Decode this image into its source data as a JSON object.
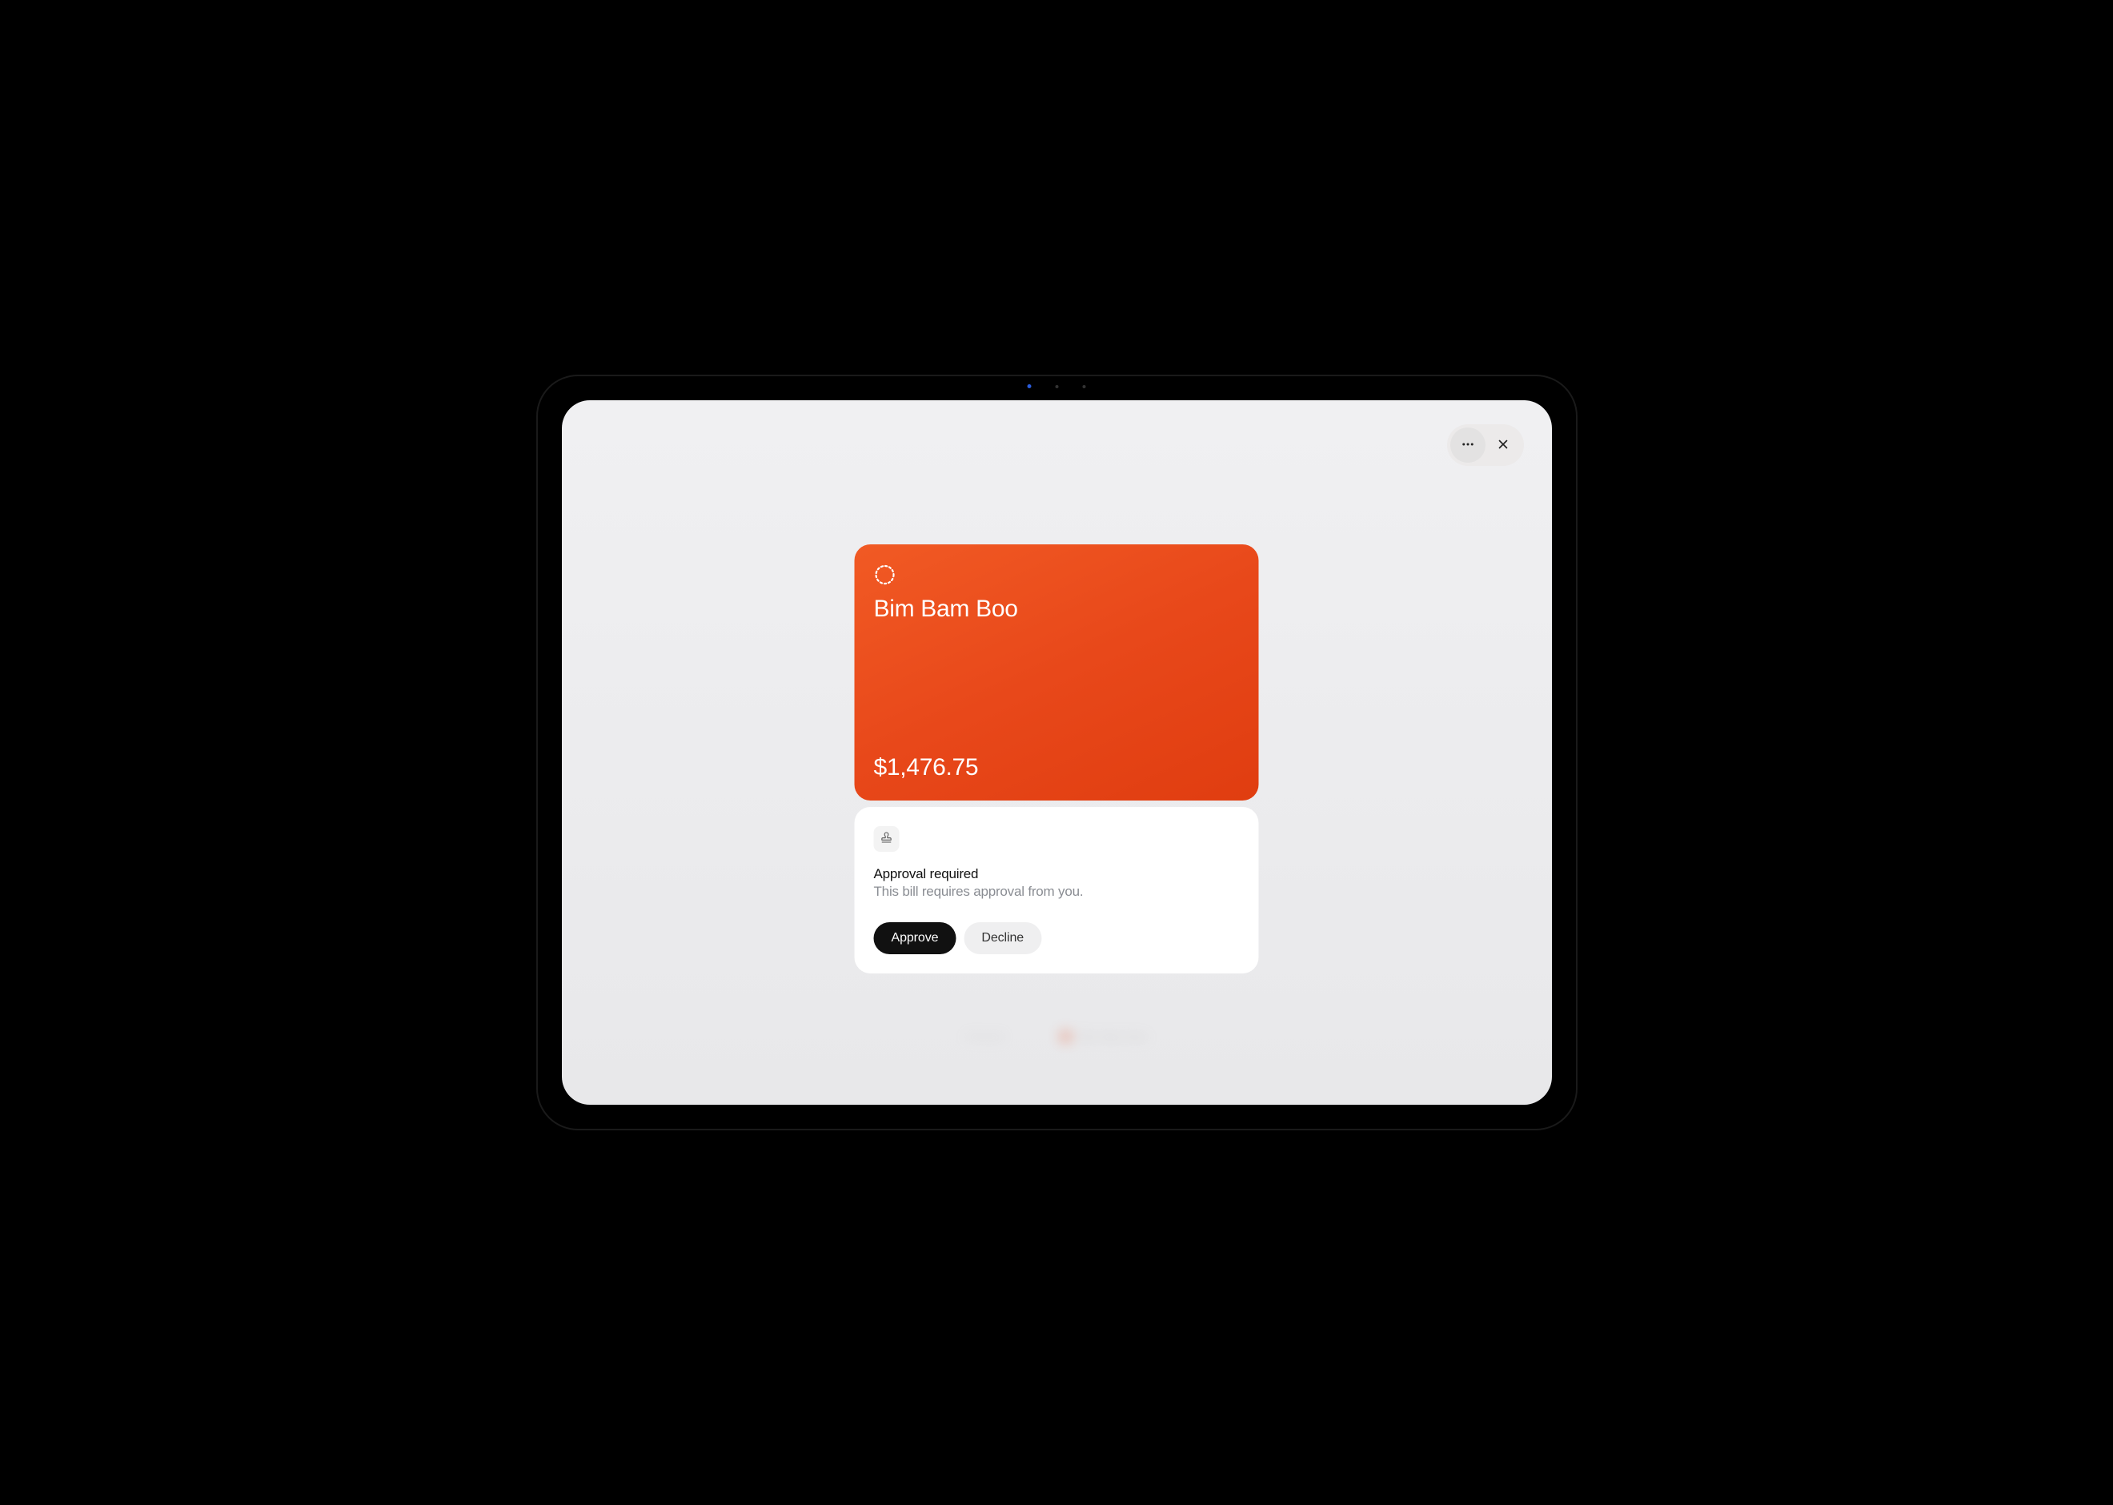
{
  "bill": {
    "title": "Bim Bam Boo",
    "amount": "$1,476.75"
  },
  "approval": {
    "title": "Approval required",
    "subtitle": "This bill requires approval from you.",
    "approve_label": "Approve",
    "decline_label": "Decline"
  },
  "reflection": {
    "left": "Amount",
    "center": "Bim Bam Boo"
  },
  "icons": {
    "more": "more-icon",
    "close": "close-icon",
    "dotted_circle": "dotted-circle-icon",
    "stamp": "stamp-icon"
  }
}
